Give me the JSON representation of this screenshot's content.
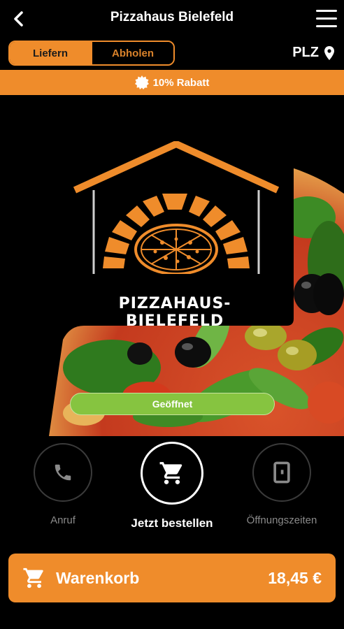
{
  "header": {
    "title": "Pizzahaus Bielefeld"
  },
  "order_mode": {
    "options": [
      "Liefern",
      "Abholen"
    ],
    "selected": "Liefern"
  },
  "location": {
    "label": "PLZ"
  },
  "promo": {
    "text": "10% Rabatt"
  },
  "hero": {
    "logo_text": "PIZZAHAUS-BIELEFELD",
    "status": "Geöffnet"
  },
  "actions": [
    {
      "label": "Anruf",
      "icon": "phone-icon"
    },
    {
      "label": "Jetzt bestellen",
      "icon": "cart-icon"
    },
    {
      "label": "Öffnungszeiten",
      "icon": "door-icon"
    }
  ],
  "cart": {
    "label": "Warenkorb",
    "total": "18,45 €"
  },
  "colors": {
    "accent": "#ef8c2b",
    "open_status": "#86c440",
    "background": "#000000"
  }
}
